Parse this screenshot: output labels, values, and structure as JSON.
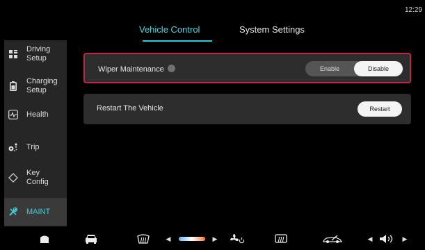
{
  "status": {
    "time": "12:29"
  },
  "tabs": [
    {
      "label": "Vehicle Control",
      "active": true
    },
    {
      "label": "System Settings",
      "active": false
    }
  ],
  "sidebar": {
    "items": [
      {
        "label": "Driving\nSetup",
        "icon": "driving-setup-icon"
      },
      {
        "label": "Charging\nSetup",
        "icon": "battery-icon"
      },
      {
        "label": "Health",
        "icon": "health-icon"
      },
      {
        "label": "Trip",
        "icon": "trip-icon"
      },
      {
        "label": "Key\nConfig",
        "icon": "key-diamond-icon"
      },
      {
        "label": "MAINT",
        "icon": "wrench-icon",
        "active": true
      }
    ]
  },
  "settings": {
    "wiper": {
      "label": "Wiper Maintenance",
      "options": [
        "Enable",
        "Disable"
      ],
      "selected": "Disable"
    },
    "restart": {
      "label": "Restart The Vehicle",
      "button": "Restart"
    }
  },
  "colors": {
    "accent": "#2ec8d8",
    "highlight_border": "#c0264a",
    "card_bg": "#2d2d2d",
    "sidebar_bg": "#262626"
  }
}
